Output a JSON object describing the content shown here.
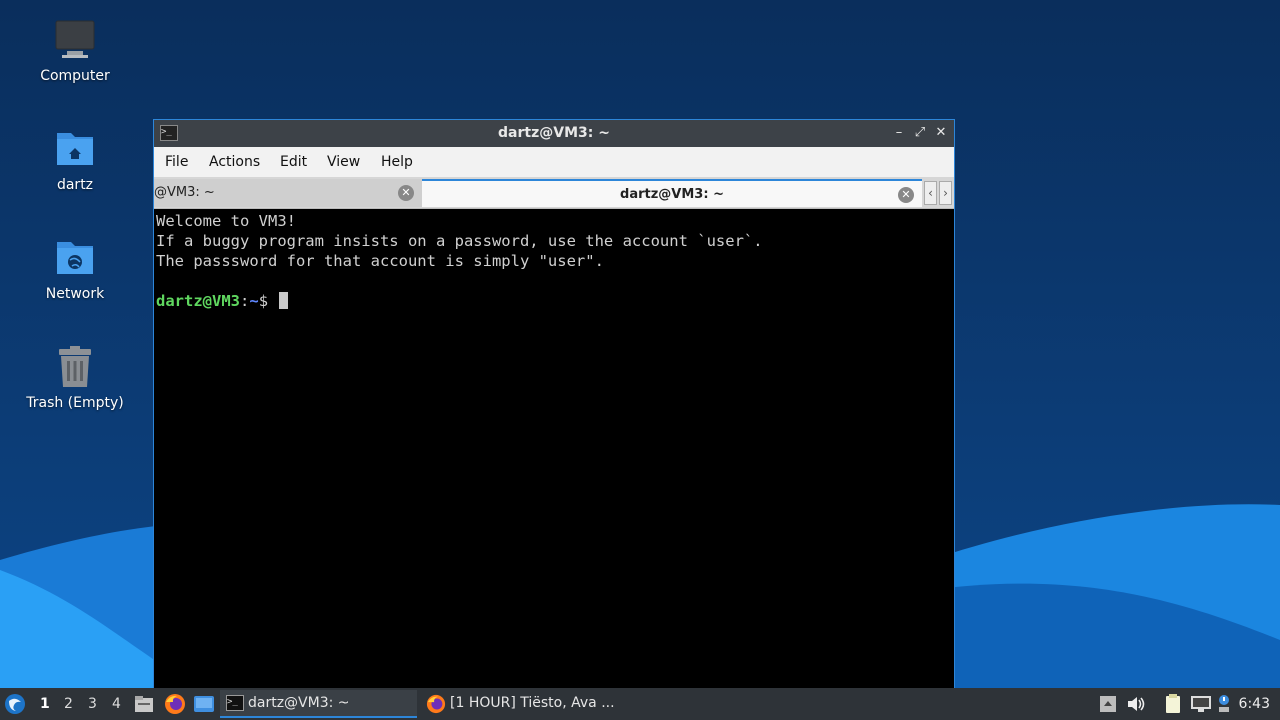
{
  "desktop": {
    "icons": [
      {
        "label": "Computer",
        "icon": "computer-icon"
      },
      {
        "label": "dartz",
        "icon": "home-folder-icon"
      },
      {
        "label": "Network",
        "icon": "network-folder-icon"
      },
      {
        "label": "Trash (Empty)",
        "icon": "trash-icon"
      }
    ]
  },
  "window": {
    "title": "dartz@VM3: ~",
    "controls": {
      "minimize": "–",
      "maximize": "⤢",
      "close": "✕"
    },
    "menu": [
      "File",
      "Actions",
      "Edit",
      "View",
      "Help"
    ],
    "tabs": [
      {
        "label": "@VM3: ~",
        "active": false
      },
      {
        "label": "dartz@VM3: ~",
        "active": true
      }
    ],
    "tab_nav": {
      "prev": "‹",
      "next": "›"
    },
    "terminal": {
      "lines": [
        "Welcome to VM3!",
        "If a buggy program insists on a password, use the account `user`.",
        "The passsword for that account is simply \"user\"."
      ],
      "prompt_user": "dartz@VM3",
      "prompt_sep": ":",
      "prompt_path": "~",
      "prompt_symbol": "$ "
    }
  },
  "taskbar": {
    "workspaces": [
      "1",
      "2",
      "3",
      "4"
    ],
    "active_workspace": "1",
    "tasks": [
      {
        "label": "dartz@VM3: ~",
        "icon": "terminal-icon",
        "active": true
      },
      {
        "label": "[1 HOUR] Tiësto, Ava ...",
        "icon": "firefox-icon",
        "active": false
      }
    ],
    "clock": "6:43"
  },
  "colors": {
    "accent": "#2d86d9",
    "prompt_user": "#5fd75f",
    "prompt_path": "#5f87ff",
    "taskbar_bg": "#2e3338"
  }
}
